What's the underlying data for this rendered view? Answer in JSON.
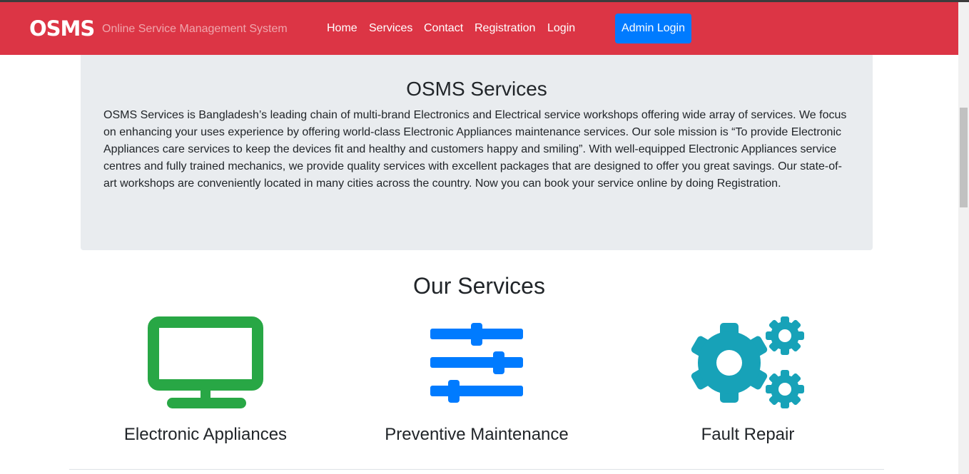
{
  "navbar": {
    "brand": "OSMS",
    "subtitle": "Online Service Management System",
    "links": [
      "Home",
      "Services",
      "Contact",
      "Registration",
      "Login"
    ],
    "admin_button": "Admin Login",
    "background": "#dc3545",
    "button_color": "#007bff"
  },
  "jumbotron": {
    "title": "OSMS Services",
    "text": "OSMS Services is Bangladesh’s leading chain of multi-brand Electronics and Electrical service workshops offering wide array of services. We focus on enhancing your uses experience by offering world-class Electronic Appliances maintenance services. Our sole mission is “To provide Electronic Appliances care services to keep the devices fit and healthy and customers happy and smiling”. With well-equipped Electronic Appliances service centres and fully trained mechanics, we provide quality services with excellent packages that are designed to offer you great savings. Our state-of-art workshops are conveniently located in many cities across the country. Now you can book your service online by doing Registration."
  },
  "services": {
    "title": "Our Services",
    "items": [
      {
        "label": "Electronic Appliances",
        "icon": "tv-icon",
        "color": "#28a745"
      },
      {
        "label": "Preventive Maintenance",
        "icon": "sliders-icon",
        "color": "#007bff"
      },
      {
        "label": "Fault Repair",
        "icon": "cogs-icon",
        "color": "#17a2b8"
      }
    ]
  }
}
